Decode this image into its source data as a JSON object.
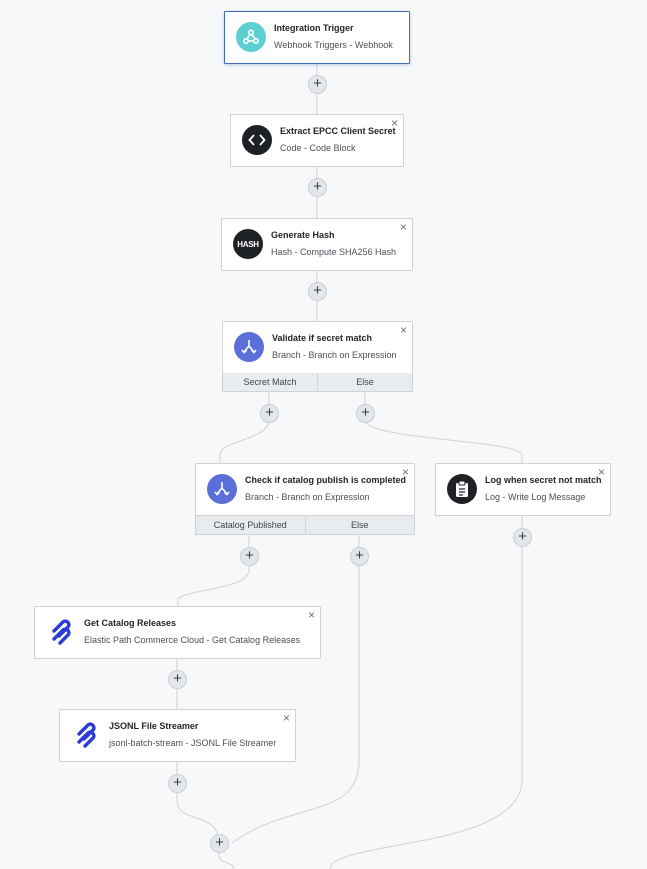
{
  "nodes": {
    "trigger": {
      "title": "Integration Trigger",
      "subtitle": "Webhook Triggers - Webhook"
    },
    "extract": {
      "title": "Extract EPCC Client Secret",
      "subtitle": "Code - Code Block"
    },
    "hash": {
      "title": "Generate Hash",
      "subtitle": "Hash - Compute SHA256 Hash",
      "icon_text": "HASH"
    },
    "validate": {
      "title": "Validate if secret match",
      "subtitle": "Branch - Branch on Expression",
      "branches": [
        "Secret Match",
        "Else"
      ]
    },
    "catalog_check": {
      "title": "Check if catalog publish is completed",
      "subtitle": "Branch - Branch on Expression",
      "branches": [
        "Catalog Published",
        "Else"
      ]
    },
    "log": {
      "title": "Log when secret not match",
      "subtitle": "Log - Write Log Message"
    },
    "releases": {
      "title": "Get Catalog Releases",
      "subtitle": "Elastic Path Commerce Cloud - Get Catalog Releases"
    },
    "streamer": {
      "title": "JSONL File Streamer",
      "subtitle": "jsonl-batch-stream - JSONL File Streamer"
    }
  },
  "labels": {
    "close": "×",
    "add": "+"
  },
  "colors": {
    "webhook": "#5ccfd3",
    "code": "#1e2226",
    "branch": "#5b6fd9",
    "epcc": "#2b3ad6",
    "selected_border": "#3f6fb6"
  },
  "icons": {
    "trigger": "webhook-icon",
    "extract": "code-icon",
    "hash": "hash-icon",
    "branch": "branch-icon",
    "log": "clipboard-icon",
    "epcc": "elastic-path-icon"
  }
}
